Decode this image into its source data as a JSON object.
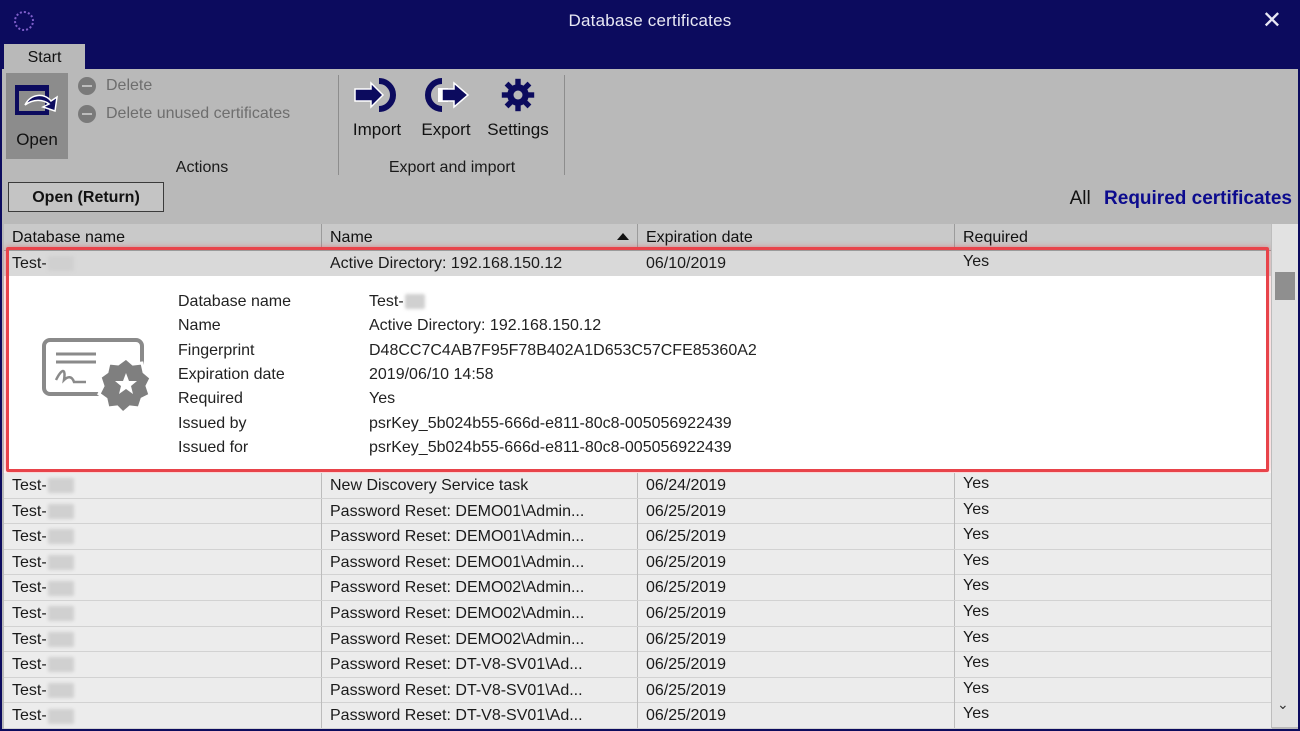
{
  "window": {
    "title": "Database certificates",
    "close_glyph": "✕"
  },
  "ribbon": {
    "tab_label": "Start",
    "open_label": "Open",
    "delete_label": "Delete",
    "delete_unused_label": "Delete unused certificates",
    "actions_group": "Actions",
    "import_label": "Import",
    "export_label": "Export",
    "settings_label": "Settings",
    "export_import_group": "Export and import"
  },
  "toolbar": {
    "open_return_label": "Open (Return)",
    "filter_all": "All",
    "filter_required": "Required certificates"
  },
  "table": {
    "columns": [
      "Database name",
      "Name",
      "Expiration date",
      "Required"
    ],
    "rows": [
      {
        "db": "Test-",
        "name": "Active Directory: 192.168.150.12",
        "expires": "06/10/2019",
        "required": "Yes"
      },
      {
        "db": "Test-",
        "name": "New Discovery Service task",
        "expires": "06/24/2019",
        "required": "Yes"
      },
      {
        "db": "Test-",
        "name": "Password Reset: DEMO01\\Admin...",
        "expires": "06/25/2019",
        "required": "Yes"
      },
      {
        "db": "Test-",
        "name": "Password Reset: DEMO01\\Admin...",
        "expires": "06/25/2019",
        "required": "Yes"
      },
      {
        "db": "Test-",
        "name": "Password Reset: DEMO01\\Admin...",
        "expires": "06/25/2019",
        "required": "Yes"
      },
      {
        "db": "Test-",
        "name": "Password Reset: DEMO02\\Admin...",
        "expires": "06/25/2019",
        "required": "Yes"
      },
      {
        "db": "Test-",
        "name": "Password Reset: DEMO02\\Admin...",
        "expires": "06/25/2019",
        "required": "Yes"
      },
      {
        "db": "Test-",
        "name": "Password Reset: DEMO02\\Admin...",
        "expires": "06/25/2019",
        "required": "Yes"
      },
      {
        "db": "Test-",
        "name": "Password Reset: DT-V8-SV01\\Ad...",
        "expires": "06/25/2019",
        "required": "Yes"
      },
      {
        "db": "Test-",
        "name": "Password Reset: DT-V8-SV01\\Ad...",
        "expires": "06/25/2019",
        "required": "Yes"
      },
      {
        "db": "Test-",
        "name": "Password Reset: DT-V8-SV01\\Ad...",
        "expires": "06/25/2019",
        "required": "Yes"
      }
    ]
  },
  "detail": {
    "labels": [
      "Database name",
      "Name",
      "Fingerprint",
      "Expiration date",
      "Required",
      "Issued by",
      "Issued for"
    ],
    "values": [
      "Test-",
      "Active Directory: 192.168.150.12",
      "D48CC7C4AB7F95F78B402A1D653C57CFE85360A2",
      "2019/06/10 14:58",
      "Yes",
      "psrKey_5b024b55-666d-e811-80c8-005056922439",
      "psrKey_5b024b55-666d-e811-80c8-005056922439"
    ]
  },
  "colors": {
    "titlebar": "#0c0b5e",
    "highlight_border": "#e8434a",
    "link": "#0c0b8e",
    "icon_dark": "#0c0b5e"
  }
}
